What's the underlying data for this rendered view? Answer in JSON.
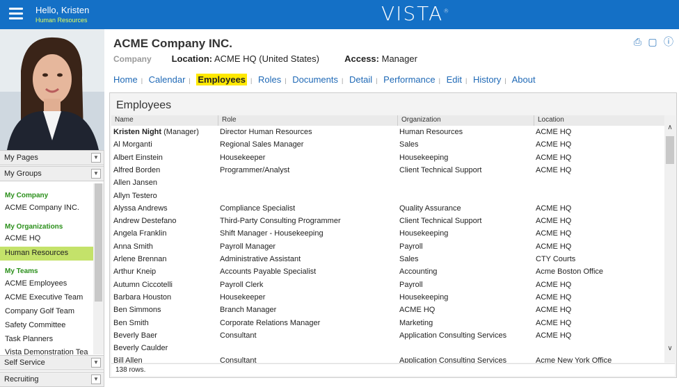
{
  "header": {
    "greeting": "Hello, Kristen",
    "subtitle": "Human Resources",
    "logo": "VISTA",
    "logo_mark": "®"
  },
  "sidebar": {
    "my_pages": "My Pages",
    "my_groups": "My Groups",
    "sections": [
      {
        "title": "My Company",
        "items": [
          "ACME Company INC."
        ]
      },
      {
        "title": "My Organizations",
        "items": [
          "ACME HQ",
          "Human Resources"
        ]
      },
      {
        "title": "My Teams",
        "items": [
          "ACME Employees",
          "ACME Executive Team",
          "Company Golf Team",
          "Safety Committee",
          "Task Planners",
          "Vista Demonstration Tea"
        ]
      }
    ],
    "self_service": "Self Service",
    "recruiting": "Recruiting"
  },
  "company": {
    "name": "ACME Company INC.",
    "type_label": "Company",
    "location_label": "Location:",
    "location_value": "ACME HQ (United States)",
    "access_label": "Access:",
    "access_value": "Manager"
  },
  "nav": [
    "Home",
    "Calendar",
    "Employees",
    "Roles",
    "Documents",
    "Detail",
    "Performance",
    "Edit",
    "History",
    "About"
  ],
  "panel": {
    "title": "Employees",
    "columns": [
      "Name",
      "Role",
      "Organization",
      "Location"
    ],
    "rows": [
      [
        "Kristen Night",
        "Director Human Resources",
        "Human Resources",
        "ACME HQ"
      ],
      [
        "Al Morganti",
        "Regional Sales Manager",
        "Sales",
        "ACME HQ"
      ],
      [
        "Albert Einstein",
        "Housekeeper",
        "Housekeeping",
        "ACME HQ"
      ],
      [
        "Alfred Borden",
        "Programmer/Analyst",
        "Client Technical Support",
        "ACME HQ"
      ],
      [
        "Allen Jansen",
        "",
        "",
        ""
      ],
      [
        "Allyn Testero",
        "",
        "",
        ""
      ],
      [
        "Alyssa Andrews",
        "Compliance Specialist",
        "Quality Assurance",
        "ACME HQ"
      ],
      [
        "Andrew Destefano",
        "Third-Party Consulting Programmer",
        "Client Technical Support",
        "ACME HQ"
      ],
      [
        "Angela Franklin",
        "Shift Manager - Housekeeping",
        "Housekeeping",
        "ACME HQ"
      ],
      [
        "Anna Smith",
        "Payroll Manager",
        "Payroll",
        "ACME HQ"
      ],
      [
        "Arlene Brennan",
        "Administrative Assistant",
        "Sales",
        "CTY Courts"
      ],
      [
        "Arthur Kneip",
        "Accounts Payable Specialist",
        "Accounting",
        "Acme Boston Office"
      ],
      [
        "Autumn Ciccotelli",
        "Payroll Clerk",
        "Payroll",
        "ACME HQ"
      ],
      [
        "Barbara Houston",
        "Housekeeper",
        "Housekeeping",
        "ACME HQ"
      ],
      [
        "Ben Simmons",
        "Branch Manager",
        "ACME HQ",
        "ACME HQ"
      ],
      [
        "Ben Smith",
        "Corporate Relations Manager",
        "Marketing",
        "ACME HQ"
      ],
      [
        "Beverly Baer",
        "Consultant",
        "Application Consulting Services",
        "ACME HQ"
      ],
      [
        "Beverly Caulder",
        "",
        "",
        ""
      ],
      [
        "Bill Allen",
        "Consultant",
        "Application Consulting Services",
        "Acme New York Office"
      ]
    ],
    "manager_suffix": "(Manager)",
    "footer": "138 rows."
  }
}
